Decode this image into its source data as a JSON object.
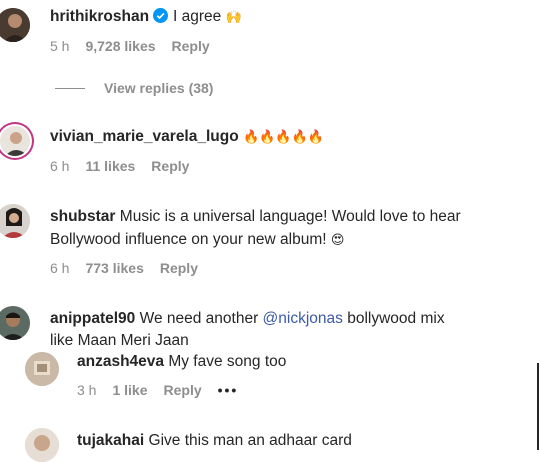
{
  "comments": [
    {
      "username": "hrithikroshan",
      "verified": true,
      "text": "I agree",
      "emoji": "🙌",
      "time": "5 h",
      "likes": "9,728 likes",
      "reply": "Reply",
      "view_replies": "View replies (38)"
    },
    {
      "username": "vivian_marie_varela_lugo",
      "text": "",
      "emoji": "🔥🔥🔥🔥🔥",
      "time": "6 h",
      "likes": "11 likes",
      "reply": "Reply"
    },
    {
      "username": "shubstar",
      "text_line1": "Music is a universal language! Would love to hear",
      "text_line2": "Bollywood influence on your new album!",
      "emoji": "😍",
      "time": "6 h",
      "likes": "773 likes",
      "reply": "Reply"
    },
    {
      "username": "anippatel90",
      "text_pre": "We need another",
      "mention": "@nickjonas",
      "text_post": "bollywood mix",
      "text_line2": "like Maan Meri Jaan"
    }
  ],
  "replies": [
    {
      "username": "anzash4eva",
      "text": "My fave song too",
      "time": "3 h",
      "likes": "1 like",
      "reply": "Reply",
      "more": "•••"
    },
    {
      "username": "tujakahai",
      "text": "Give this man an adhaar card"
    }
  ],
  "colors": {
    "text": "#262626",
    "meta": "#8e8e8e",
    "link": "#3d5aa8",
    "verified": "#0095f6",
    "story_ring": "#c13584"
  }
}
